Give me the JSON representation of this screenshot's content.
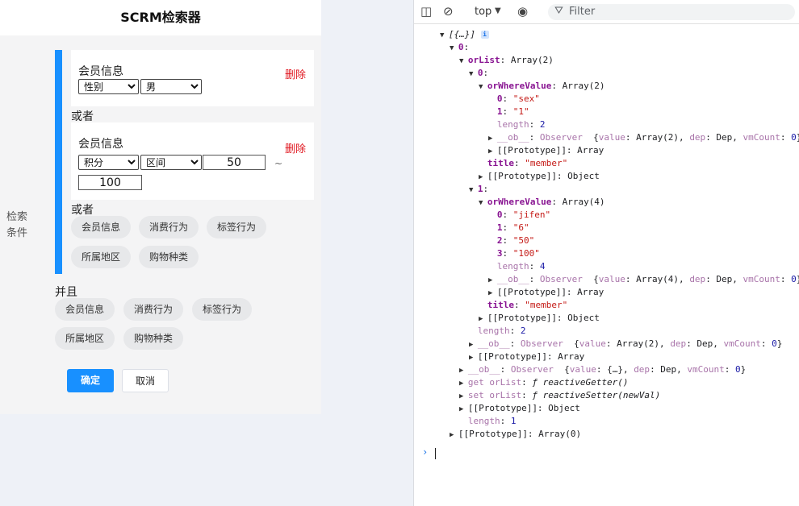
{
  "app": {
    "title": "SCRM检索器",
    "side_label": "检索条件",
    "card1": {
      "title": "会员信息",
      "delete": "删除",
      "select1": "性别",
      "select2": "男"
    },
    "or1": "或者",
    "card2": {
      "title": "会员信息",
      "delete": "删除",
      "select1": "积分",
      "select2": "区间",
      "from": "50",
      "tilde": "~",
      "to": "100"
    },
    "or2": "或者",
    "group_or_pills": [
      "会员信息",
      "消费行为",
      "标签行为",
      "所属地区",
      "购物种类"
    ],
    "and_label": "并且",
    "group_and_pills": [
      "会员信息",
      "消费行为",
      "标签行为",
      "所属地区",
      "购物种类"
    ],
    "confirm": "确定",
    "cancel": "取消"
  },
  "devtools": {
    "context": "top",
    "filter_placeholder": "Filter",
    "prompt": "›",
    "lines": [
      {
        "i": 0,
        "t": "v",
        "h": "<span class=\"f\">[{…}]</span> <span class=\"info-i\">i</span>"
      },
      {
        "i": 1,
        "t": "v",
        "h": "<span class=\"k\">0</span>:"
      },
      {
        "i": 2,
        "t": "v",
        "h": "<span class=\"k\">orList</span>: Array(2)"
      },
      {
        "i": 3,
        "t": "v",
        "h": "<span class=\"k\">0</span>:"
      },
      {
        "i": 4,
        "t": "v",
        "h": "<span class=\"k\">orWhereValue</span>: Array(2)"
      },
      {
        "i": 5,
        "t": "",
        "h": "<span class=\"k\">0</span>: <span class=\"s\">\"sex\"</span>"
      },
      {
        "i": 5,
        "t": "",
        "h": "<span class=\"k\">1</span>: <span class=\"s\">\"1\"</span>"
      },
      {
        "i": 5,
        "t": "",
        "h": "<span class=\"kd\">length</span>: <span class=\"n\">2</span>"
      },
      {
        "i": 5,
        "t": ">",
        "h": "<span class=\"kd\">__ob__</span>: <span class=\"kd\">Observer</span>  {<span class=\"kd\">value</span>: Array(2), <span class=\"kd\">dep</span>: Dep, <span class=\"kd\">vmCount</span>: <span class=\"n\">0</span>}"
      },
      {
        "i": 5,
        "t": ">",
        "h": "[[Prototype]]: Array"
      },
      {
        "i": 4,
        "t": "",
        "h": "<span class=\"k\">title</span>: <span class=\"s\">\"member\"</span>"
      },
      {
        "i": 4,
        "t": ">",
        "h": "[[Prototype]]: Object"
      },
      {
        "i": 3,
        "t": "v",
        "h": "<span class=\"k\">1</span>:"
      },
      {
        "i": 4,
        "t": "v",
        "h": "<span class=\"k\">orWhereValue</span>: Array(4)"
      },
      {
        "i": 5,
        "t": "",
        "h": "<span class=\"k\">0</span>: <span class=\"s\">\"jifen\"</span>"
      },
      {
        "i": 5,
        "t": "",
        "h": "<span class=\"k\">1</span>: <span class=\"s\">\"6\"</span>"
      },
      {
        "i": 5,
        "t": "",
        "h": "<span class=\"k\">2</span>: <span class=\"s\">\"50\"</span>"
      },
      {
        "i": 5,
        "t": "",
        "h": "<span class=\"k\">3</span>: <span class=\"s\">\"100\"</span>"
      },
      {
        "i": 5,
        "t": "",
        "h": "<span class=\"kd\">length</span>: <span class=\"n\">4</span>"
      },
      {
        "i": 5,
        "t": ">",
        "h": "<span class=\"kd\">__ob__</span>: <span class=\"kd\">Observer</span>  {<span class=\"kd\">value</span>: Array(4), <span class=\"kd\">dep</span>: Dep, <span class=\"kd\">vmCount</span>: <span class=\"n\">0</span>}"
      },
      {
        "i": 5,
        "t": ">",
        "h": "[[Prototype]]: Array"
      },
      {
        "i": 4,
        "t": "",
        "h": "<span class=\"k\">title</span>: <span class=\"s\">\"member\"</span>"
      },
      {
        "i": 4,
        "t": ">",
        "h": "[[Prototype]]: Object"
      },
      {
        "i": 3,
        "t": "",
        "h": "<span class=\"kd\">length</span>: <span class=\"n\">2</span>"
      },
      {
        "i": 3,
        "t": ">",
        "h": "<span class=\"kd\">__ob__</span>: <span class=\"kd\">Observer</span>  {<span class=\"kd\">value</span>: Array(2), <span class=\"kd\">dep</span>: Dep, <span class=\"kd\">vmCount</span>: <span class=\"n\">0</span>}"
      },
      {
        "i": 3,
        "t": ">",
        "h": "[[Prototype]]: Array"
      },
      {
        "i": 2,
        "t": ">",
        "h": "<span class=\"kd\">__ob__</span>: <span class=\"kd\">Observer</span>  {<span class=\"kd\">value</span>: {…}, <span class=\"kd\">dep</span>: Dep, <span class=\"kd\">vmCount</span>: <span class=\"n\">0</span>}"
      },
      {
        "i": 2,
        "t": ">",
        "h": "<span class=\"kd\">get orList</span>: <span class=\"f\">ƒ reactiveGetter()</span>"
      },
      {
        "i": 2,
        "t": ">",
        "h": "<span class=\"kd\">set orList</span>: <span class=\"f\">ƒ reactiveSetter(newVal)</span>"
      },
      {
        "i": 2,
        "t": ">",
        "h": "[[Prototype]]: Object"
      },
      {
        "i": 2,
        "t": "",
        "h": "<span class=\"kd\">length</span>: <span class=\"n\">1</span>"
      },
      {
        "i": 1,
        "t": ">",
        "h": "[[Prototype]]: Array(0)"
      }
    ]
  }
}
